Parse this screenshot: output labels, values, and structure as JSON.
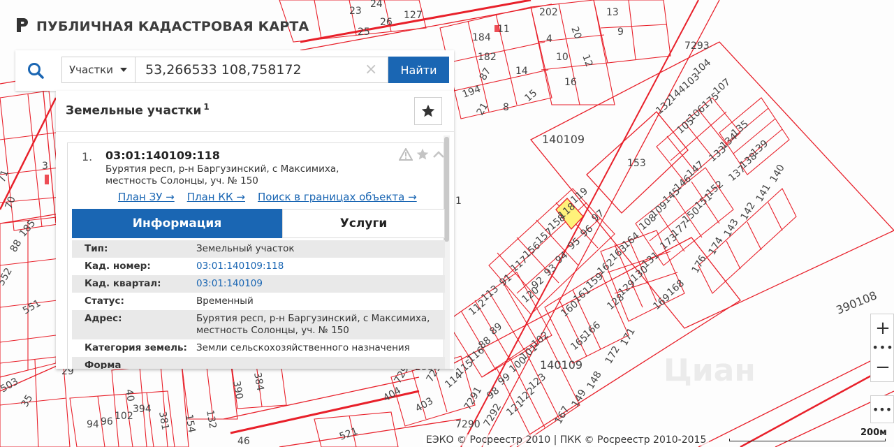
{
  "brand": {
    "title": "ПУБЛИЧНАЯ КАДАСТРОВАЯ КАРТА",
    "icon": "pkk-logo-icon"
  },
  "search": {
    "type_label": "Участки",
    "value": "53,266533 108,758172",
    "clear_symbol": "×",
    "button_label": "Найти"
  },
  "panel": {
    "title": "Земельные участки",
    "count": "1",
    "item": {
      "num": "1.",
      "cadastral": "03:01:140109:118",
      "address": "Бурятия респ, р-н Баргузинский, с Максимиха, местность Солонцы, уч. № 150",
      "links": [
        "План ЗУ →",
        "План КК →",
        "Поиск в границах объекта →"
      ]
    },
    "tabs": {
      "info": "Информация",
      "services": "Услуги"
    },
    "rows": [
      {
        "k": "Тип:",
        "v": "Земельный участок",
        "link": false
      },
      {
        "k": "Кад. номер:",
        "v": "03:01:140109:118",
        "link": true
      },
      {
        "k": "Кад. квартал:",
        "v": "03:01:140109",
        "link": true
      },
      {
        "k": "Статус:",
        "v": "Временный",
        "link": false
      },
      {
        "k": "Адрес:",
        "v": "Бурятия респ, р-н Баргузинский, с Максимиха, местность Солонцы, уч. № 150",
        "link": false
      },
      {
        "k": "Категория земель:",
        "v": "Земли сельскохозяйственного назначения",
        "link": false
      },
      {
        "k": "Форма",
        "v": "",
        "link": false
      }
    ]
  },
  "map": {
    "highlight_color": "#fff27a",
    "line_color": "#e8202a",
    "block_labels": [
      "140109",
      "140109",
      "390108"
    ],
    "parcel_labels": [
      "7293",
      "104",
      "107",
      "103",
      "175",
      "144",
      "106",
      "132",
      "105",
      "135",
      "134",
      "139",
      "133",
      "138",
      "137",
      "153",
      "119",
      "97",
      "118",
      "158",
      "96",
      "95",
      "157",
      "156",
      "94",
      "93",
      "117",
      "92",
      "91",
      "120",
      "147",
      "146",
      "152",
      "145",
      "151",
      "109",
      "150",
      "108",
      "177",
      "173",
      "140",
      "141",
      "142",
      "143",
      "174",
      "176",
      "164",
      "131",
      "163",
      "130",
      "162",
      "129",
      "159",
      "128",
      "161",
      "160",
      "166",
      "165",
      "169",
      "168",
      "171",
      "172",
      "113",
      "112",
      "89",
      "88",
      "116",
      "115",
      "114",
      "102",
      "101",
      "100",
      "123",
      "99",
      "122",
      "98",
      "121",
      "167",
      "149",
      "148",
      "7291",
      "7292",
      "7290",
      "299",
      "7298",
      "7294",
      "404",
      "403",
      "202",
      "4",
      "20",
      "10",
      "12",
      "16",
      "13",
      "9",
      "184",
      "11",
      "182",
      "87",
      "14",
      "194",
      "8",
      "15",
      "21",
      "25",
      "26",
      "127",
      "23",
      "24",
      "3",
      "71",
      "70",
      "185",
      "88",
      "552",
      "551",
      "503",
      "35",
      "29",
      "40",
      "390",
      "384",
      "154",
      "132",
      "394",
      "102",
      "96",
      "94",
      "381",
      "46",
      "521",
      "1"
    ]
  },
  "controls": {
    "zoom_in": "+",
    "zoom_dots": "•••",
    "zoom_out": "−",
    "more": "•••"
  },
  "attribution": "ЕЭКО © Росреестр 2010 | ПКК © Росреестр 2010-2015",
  "scale": "200м",
  "watermark": "Циан"
}
